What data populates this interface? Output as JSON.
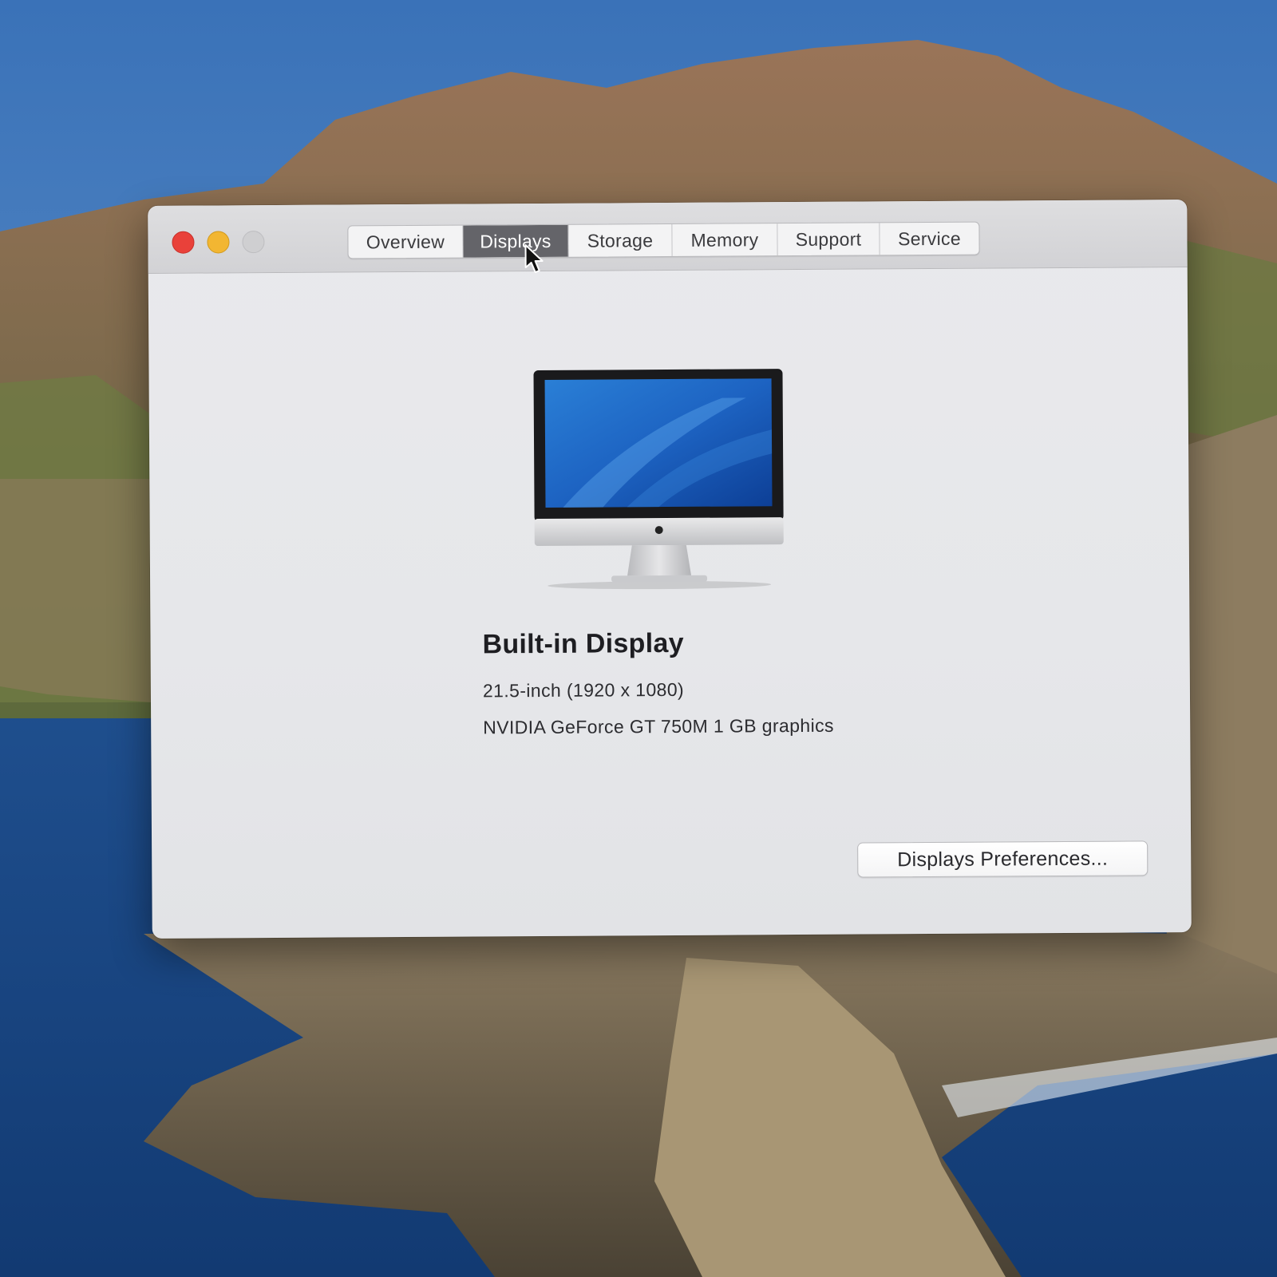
{
  "window": {
    "tabs": [
      {
        "label": "Overview",
        "selected": false
      },
      {
        "label": "Displays",
        "selected": true
      },
      {
        "label": "Storage",
        "selected": false
      },
      {
        "label": "Memory",
        "selected": false
      },
      {
        "label": "Support",
        "selected": false
      },
      {
        "label": "Service",
        "selected": false
      }
    ],
    "traffic_lights": {
      "close_color": "#e9413a",
      "minimize_color": "#f2b632",
      "zoom_color": "#cfcfd1"
    }
  },
  "display": {
    "icon": "imac-icon",
    "title": "Built-in Display",
    "size": "21.5-inch (1920 x 1080)",
    "graphics": "NVIDIA GeForce GT 750M 1 GB graphics"
  },
  "actions": {
    "preferences_button": "Displays Preferences..."
  },
  "colors": {
    "selected_tab": "#646469",
    "window_bg": "#e6e7ea",
    "desktop_sky": "#3f78bd",
    "desktop_sea": "#1d4a8a"
  }
}
